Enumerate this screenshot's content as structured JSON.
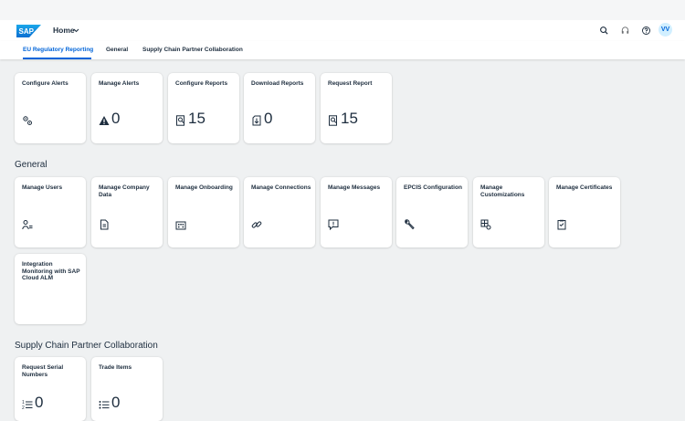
{
  "shell": {
    "logo_text": "SAP",
    "home_title": "Home",
    "avatar_initials": "VV",
    "icons": [
      "search-icon",
      "headset-icon",
      "help-icon"
    ]
  },
  "tabs": [
    {
      "label": "EU Regulatory Reporting",
      "active": true
    },
    {
      "label": "General",
      "active": false
    },
    {
      "label": "Supply Chain Partner Collaboration",
      "active": false
    }
  ],
  "sections": {
    "eu": {
      "tiles": [
        {
          "title": "Configure Alerts",
          "icon": "gears-icon",
          "value": ""
        },
        {
          "title": "Manage Alerts",
          "icon": "warning-icon",
          "value": "0"
        },
        {
          "title": "Configure Reports",
          "icon": "report-icon",
          "value": "15"
        },
        {
          "title": "Download Reports",
          "icon": "download-icon",
          "value": "0"
        },
        {
          "title": "Request Report",
          "icon": "report-icon",
          "value": "15"
        }
      ]
    },
    "general": {
      "title": "General",
      "tiles": [
        {
          "title": "Manage Users",
          "icon": "user-list-icon"
        },
        {
          "title": "Manage Company Data",
          "icon": "document-icon"
        },
        {
          "title": "Manage Onboarding",
          "icon": "building-icon"
        },
        {
          "title": "Manage Connections",
          "icon": "chain-link-icon"
        },
        {
          "title": "Manage Messages",
          "icon": "message-icon"
        },
        {
          "title": "EPCIS Configuration",
          "icon": "wrench-icon"
        },
        {
          "title": "Manage Customizations",
          "icon": "table-settings-icon"
        },
        {
          "title": "Manage Certificates",
          "icon": "clipboard-icon"
        },
        {
          "title": "Integration Monitoring with SAP Cloud ALM",
          "icon": ""
        }
      ]
    },
    "scpc": {
      "title": "Supply Chain Partner Collaboration",
      "tiles": [
        {
          "title": "Request Serial Numbers",
          "icon": "numbered-list-icon",
          "value": "0"
        },
        {
          "title": "Trade Items",
          "icon": "bullet-list-icon",
          "value": "0"
        }
      ]
    }
  },
  "colors": {
    "accent": "#0064d9",
    "text": "#1d2d3e",
    "background": "#eff1f2"
  }
}
